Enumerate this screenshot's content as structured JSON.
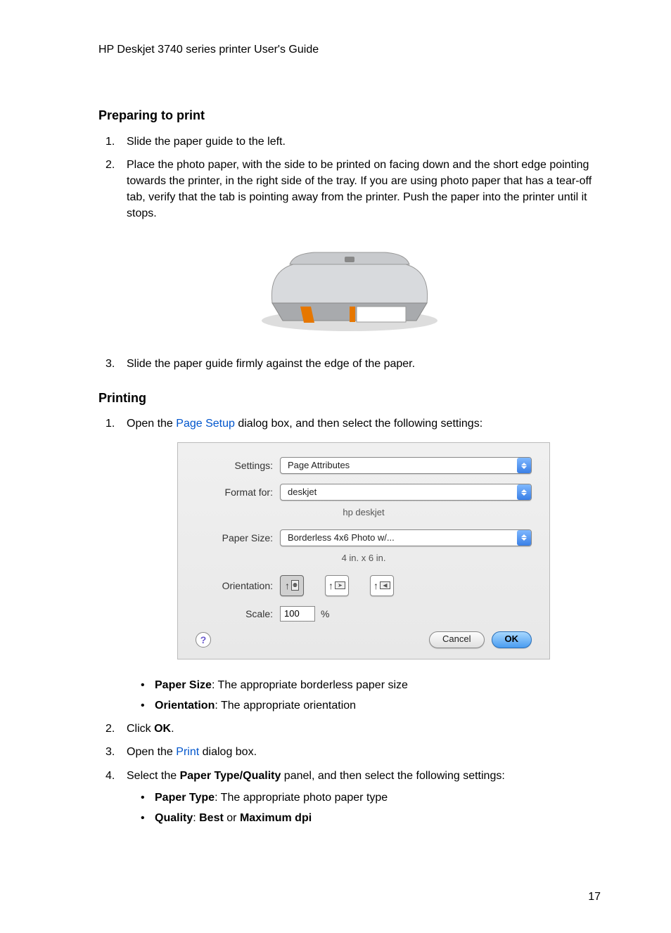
{
  "header": "HP Deskjet 3740 series printer User's Guide",
  "sections": {
    "prep": {
      "heading": "Preparing to print",
      "steps": [
        "Slide the paper guide to the left.",
        "Place the photo paper, with the side to be printed on facing down and the short edge pointing towards the printer, in the right side of the tray. If you are using photo paper that has a tear-off tab, verify that the tab is pointing away from the printer. Push the paper into the printer until it stops.",
        "Slide the paper guide firmly against the edge of the paper."
      ]
    },
    "printing": {
      "heading": "Printing",
      "step1_prefix": "Open the ",
      "step1_link": "Page Setup",
      "step1_suffix": " dialog box, and then select the following settings:",
      "bullets1": {
        "paper_size_label": "Paper Size",
        "paper_size_text": ": The appropriate borderless paper size",
        "orientation_label": "Orientation",
        "orientation_text": ": The appropriate orientation"
      },
      "step2_prefix": "Click ",
      "step2_bold": "OK",
      "step2_suffix": ".",
      "step3_prefix": "Open the ",
      "step3_link": "Print",
      "step3_suffix": " dialog box.",
      "step4_prefix": "Select the ",
      "step4_bold": "Paper Type/Quality",
      "step4_suffix": " panel, and then select the following settings:",
      "bullets2": {
        "paper_type_label": "Paper Type",
        "paper_type_text": ": The appropriate photo paper type",
        "quality_label": "Quality",
        "quality_mid": ": ",
        "quality_b1": "Best",
        "quality_or": " or ",
        "quality_b2": "Maximum dpi"
      }
    }
  },
  "dialog": {
    "settings_label": "Settings:",
    "settings_value": "Page Attributes",
    "format_label": "Format for:",
    "format_value": "deskjet",
    "format_sub": "hp deskjet",
    "papersize_label": "Paper Size:",
    "papersize_value": "Borderless 4x6 Photo w/...",
    "papersize_sub": "4 in. x 6 in.",
    "orientation_label": "Orientation:",
    "scale_label": "Scale:",
    "scale_value": "100",
    "scale_pct": "%",
    "help": "?",
    "cancel": "Cancel",
    "ok": "OK"
  },
  "page_number": "17"
}
